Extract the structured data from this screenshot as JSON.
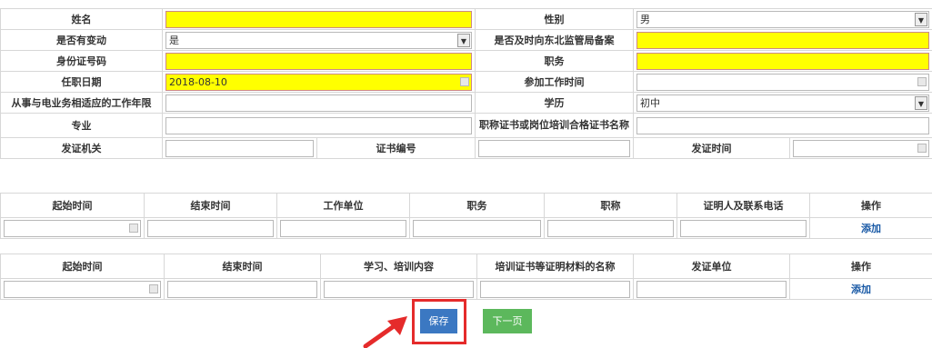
{
  "person": {
    "name_label": "姓名",
    "name_value": "",
    "gender_label": "性别",
    "gender_value": "男",
    "changed_label": "是否有变动",
    "changed_value": "是",
    "filed_label": "是否及时向东北监管局备案",
    "filed_value": "",
    "id_label": "身份证号码",
    "id_value": "",
    "position_label": "职务",
    "position_value": "",
    "appoint_date_label": "任职日期",
    "appoint_date_value": "2018-08-10",
    "work_start_label": "参加工作时间",
    "work_start_value": "",
    "years_label": "从事与电业务相适应的工作年限",
    "years_value": "",
    "education_label": "学历",
    "education_value": "初中",
    "major_label": "专业",
    "major_value": "",
    "cert_name_label": "职称证书或岗位培训合格证书名称",
    "cert_name_value": "",
    "issuer_label": "发证机关",
    "issuer_value": "",
    "cert_no_label": "证书编号",
    "cert_no_value": "",
    "issue_date_label": "发证时间",
    "issue_date_value": ""
  },
  "work_history": {
    "headers": [
      "起始时间",
      "结束时间",
      "工作单位",
      "职务",
      "职称",
      "证明人及联系电话",
      "操作"
    ],
    "add_label": "添加"
  },
  "training_history": {
    "headers": [
      "起始时间",
      "结束时间",
      "学习、培训内容",
      "培训证书等证明材料的名称",
      "发证单位",
      "操作"
    ],
    "add_label": "添加"
  },
  "actions": {
    "save_label": "保存",
    "next_label": "下一页"
  },
  "colors": {
    "required": "#ffff00",
    "save": "#3b78c2",
    "next": "#5cb85c",
    "highlight": "#e52b2b",
    "link": "#1a5aa6"
  }
}
